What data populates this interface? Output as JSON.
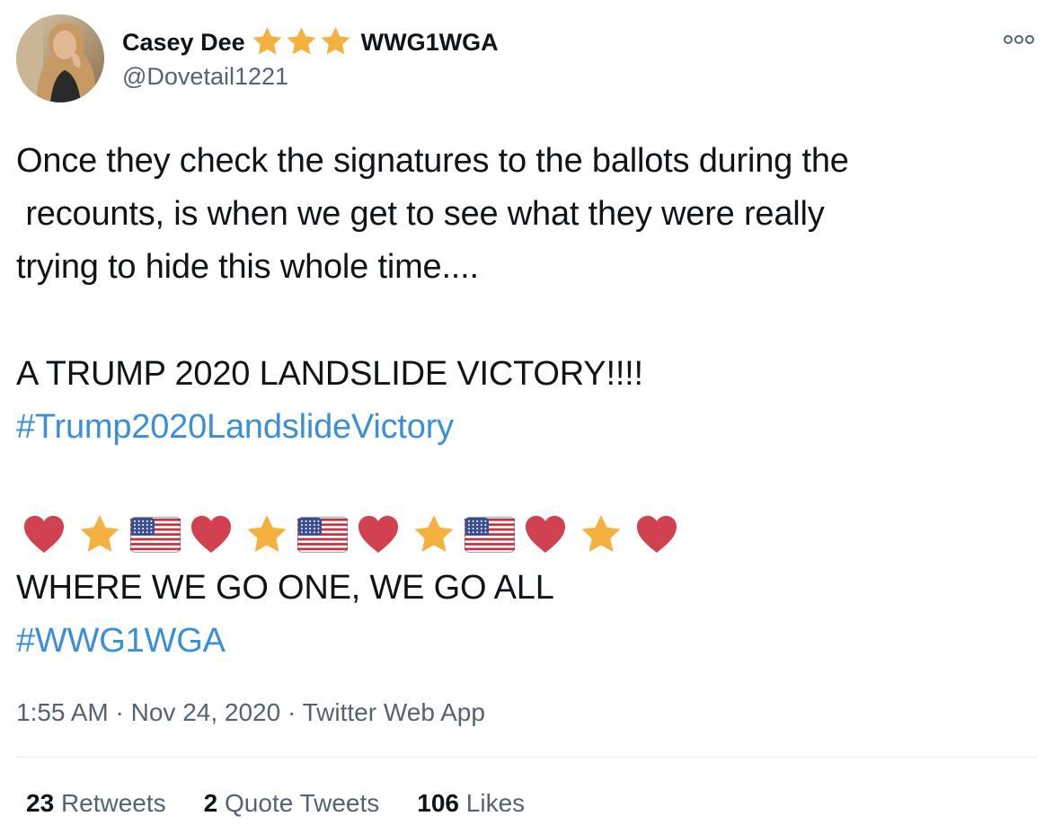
{
  "author": {
    "name": "Casey Dee",
    "name_suffix": "WWG1WGA",
    "handle": "@Dovetail1221",
    "star_color": "#f4b13e"
  },
  "tweet": {
    "lines": [
      "Once they check the signatures to the ballots during the",
      " recounts, is when we get to see what they were really",
      "trying to hide this whole time....",
      "A TRUMP 2020 LANDSLIDE VICTORY!!!!"
    ],
    "hashtag1": "#Trump2020LandslideVictory",
    "emoji_sequence": [
      "heart",
      "star",
      "us-flag",
      "heart",
      "star",
      "us-flag",
      "heart",
      "star",
      "us-flag",
      "heart",
      "star",
      "heart"
    ],
    "motto": "WHERE WE GO ONE, WE GO ALL",
    "hashtag2": "#WWG1WGA"
  },
  "meta": {
    "time": "1:55 AM",
    "date": "Nov 24, 2020",
    "source": "Twitter Web App",
    "separator": "·"
  },
  "stats": {
    "retweets_count": "23",
    "retweets_label": "Retweets",
    "quotes_count": "2",
    "quotes_label": "Quote Tweets",
    "likes_count": "106",
    "likes_label": "Likes"
  },
  "colors": {
    "hashtag": "#3b8fd9",
    "heart": "#d1414f",
    "secondary_text": "#536471"
  }
}
